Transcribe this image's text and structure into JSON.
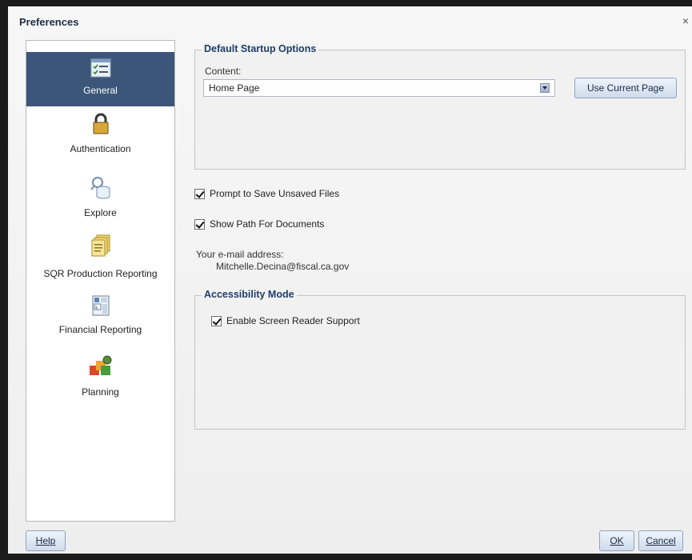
{
  "window": {
    "title": "Preferences",
    "close_glyph": "×"
  },
  "sidebar": {
    "items": [
      {
        "label": "General",
        "icon": "general-checklist-icon",
        "selected": true
      },
      {
        "label": "Authentication",
        "icon": "lock-icon"
      },
      {
        "label": "Explore",
        "icon": "explore-search-icon"
      },
      {
        "label": "SQR Production Reporting",
        "icon": "sqr-documents-icon"
      },
      {
        "label": "Financial Reporting",
        "icon": "financial-reporting-icon"
      },
      {
        "label": "Planning",
        "icon": "planning-blocks-icon"
      }
    ]
  },
  "startup": {
    "group_title": "Default Startup Options",
    "content_label": "Content:",
    "content_value": "Home Page",
    "use_current_label": "Use Current Page"
  },
  "options": {
    "prompt_save_label": "Prompt to Save Unsaved Files",
    "prompt_save_checked": true,
    "show_path_label": "Show Path For Documents",
    "show_path_checked": true
  },
  "email": {
    "label": "Your e-mail address:",
    "value": "Mitchelle.Decina@fiscal.ca.gov"
  },
  "accessibility": {
    "group_title": "Accessibility Mode",
    "screen_reader_label": "Enable Screen Reader Support",
    "screen_reader_checked": true
  },
  "footer": {
    "help_label": "Help",
    "ok_label": "OK",
    "cancel_label": "Cancel"
  },
  "colors": {
    "selected_nav": "#3b5679",
    "group_title": "#1f3e6b"
  }
}
